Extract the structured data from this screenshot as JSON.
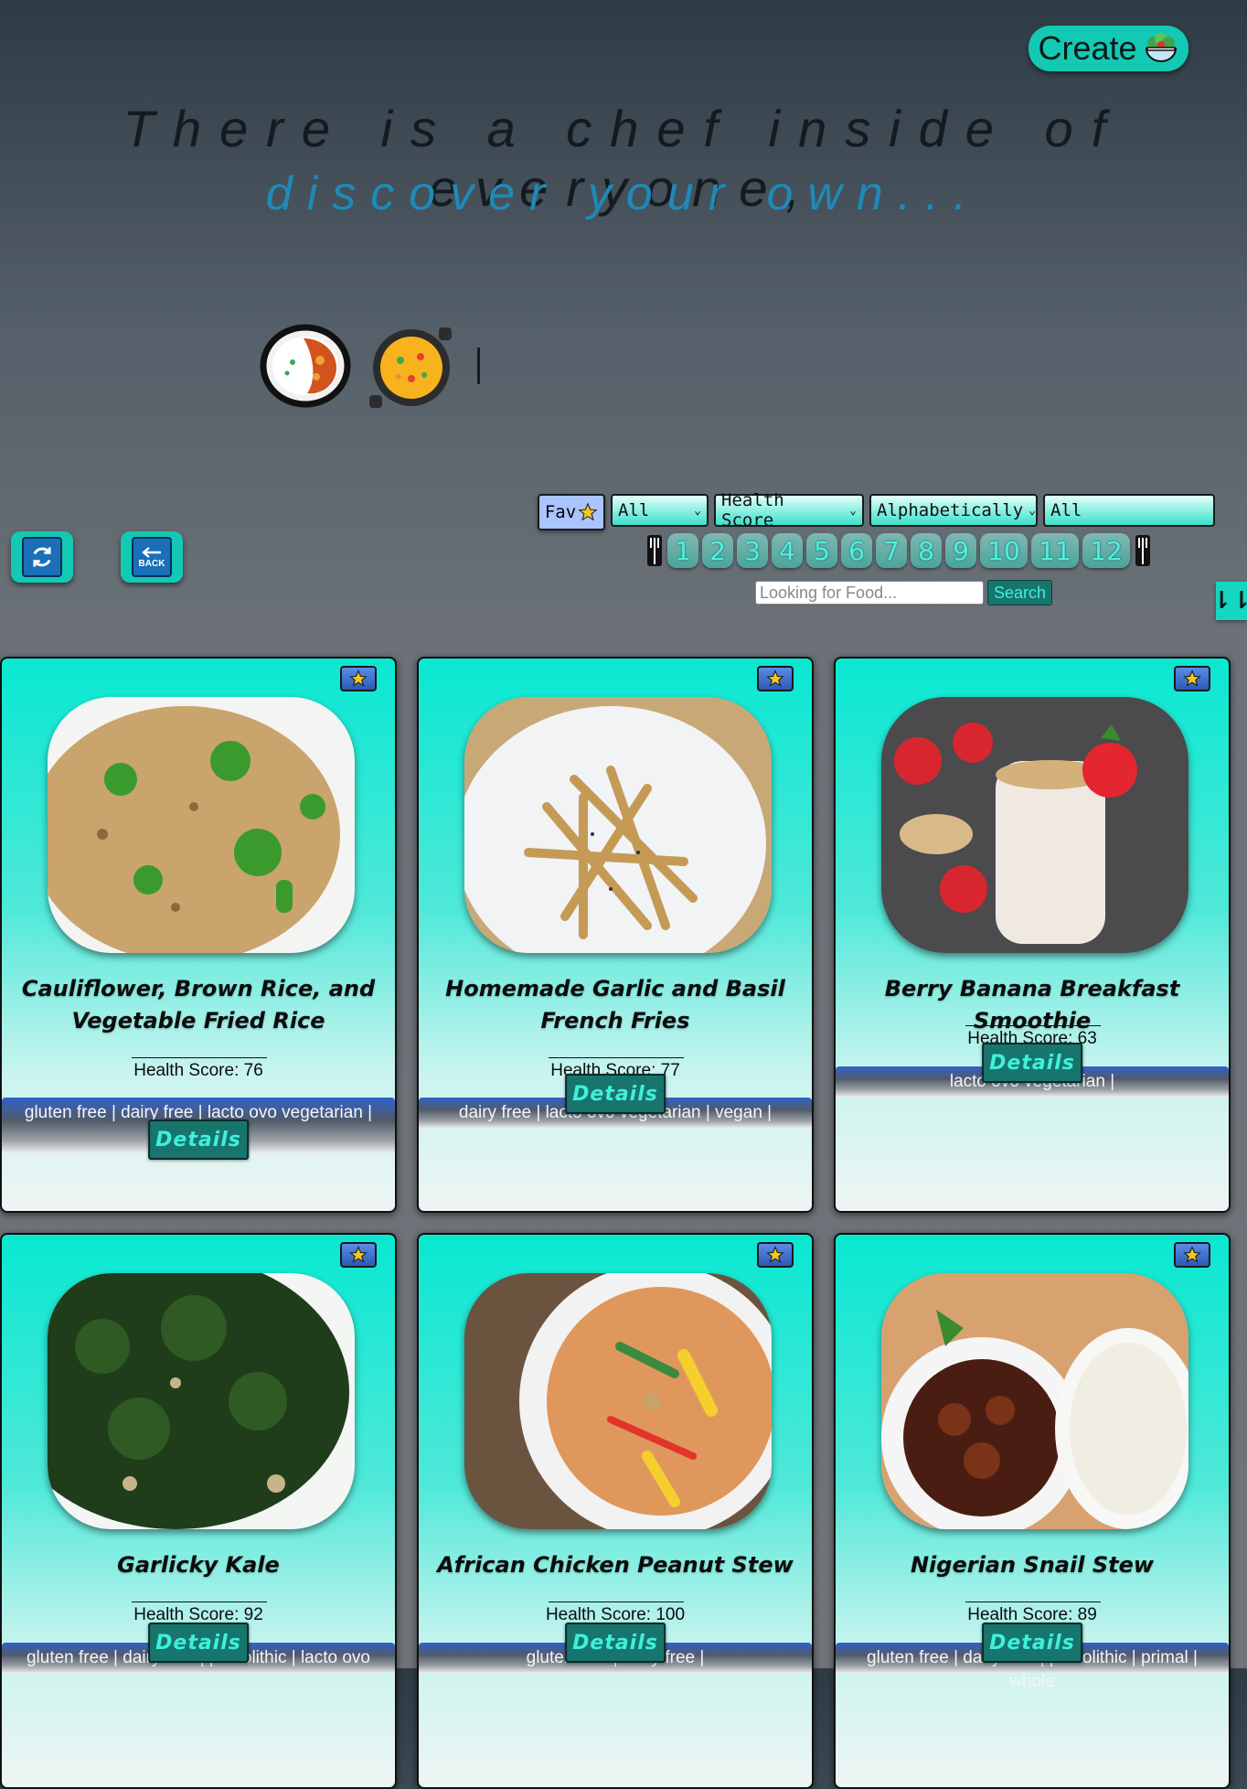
{
  "header": {
    "create_label": "Create",
    "tagline_line1": "There is a chef inside of everyone,",
    "tagline_line2": "discover your own..."
  },
  "icons": {
    "create": "salad-bowl-icon",
    "food1": "curry-rice-icon",
    "food2": "paella-pan-icon",
    "refresh": "refresh-icon",
    "back": "back-arrow-icon",
    "fav": "star-icon",
    "sort": "sort-arrows-icon",
    "pager_ends": "fork-knife-icon"
  },
  "filters": {
    "fav_label": "Fav",
    "diet_selected": "All",
    "score_selected": "Health Score",
    "order_selected": "Alphabetically",
    "origin_selected": "All"
  },
  "back_label": "BACK",
  "pagination": [
    "1",
    "2",
    "3",
    "4",
    "5",
    "6",
    "7",
    "8",
    "9",
    "10",
    "11",
    "12"
  ],
  "search": {
    "placeholder": "Looking for Food...",
    "button": "Search"
  },
  "sort_label": "⇂⇂",
  "details_label": "Details",
  "health_label_prefix": "Health Score: ",
  "cards": [
    {
      "title": "Cauliflower, Brown Rice, and Vegetable Fried Rice",
      "health": "Health Score: 76",
      "diets": "gluten free | dairy free | lacto ovo vegetarian | vegan |"
    },
    {
      "title": "Homemade Garlic and Basil French Fries",
      "health": "Health Score: 77",
      "diets": "dairy free | lacto ovo vegetarian | vegan |"
    },
    {
      "title": "Berry Banana Breakfast Smoothie",
      "health": "Health Score: 63",
      "diets": "lacto ovo vegetarian |"
    },
    {
      "title": "Garlicky Kale",
      "health": "Health Score: 92",
      "diets": "gluten free | dairy free | paleolithic | lacto ovo"
    },
    {
      "title": "African Chicken Peanut Stew",
      "health": "Health Score: 100",
      "diets": "gluten free | dairy free |"
    },
    {
      "title": "Nigerian Snail Stew",
      "health": "Health Score: 89",
      "diets": "gluten free | dairy free | paleolithic | primal | whole"
    }
  ],
  "colors": {
    "accent": "#13c9b4",
    "card_top": "#09e8d2",
    "details_bg": "#17756d",
    "details_text": "#3ff0da",
    "tagline2": "#1e8ab8"
  }
}
